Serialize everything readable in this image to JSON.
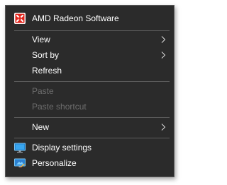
{
  "context_menu": {
    "items": [
      {
        "label": "AMD Radeon Software",
        "icon": "amd-radeon-icon",
        "enabled": true,
        "submenu": false
      },
      {
        "label": "View",
        "icon": "",
        "enabled": true,
        "submenu": true
      },
      {
        "label": "Sort by",
        "icon": "",
        "enabled": true,
        "submenu": true
      },
      {
        "label": "Refresh",
        "icon": "",
        "enabled": true,
        "submenu": false
      },
      {
        "label": "Paste",
        "icon": "",
        "enabled": false,
        "submenu": false
      },
      {
        "label": "Paste shortcut",
        "icon": "",
        "enabled": false,
        "submenu": false
      },
      {
        "label": "New",
        "icon": "",
        "enabled": true,
        "submenu": true
      },
      {
        "label": "Display settings",
        "icon": "display-settings-icon",
        "enabled": true,
        "submenu": false
      },
      {
        "label": "Personalize",
        "icon": "personalize-icon",
        "enabled": true,
        "submenu": false
      }
    ]
  },
  "colors": {
    "menu_background": "#2b2b2b",
    "text_enabled": "#ffffff",
    "text_disabled": "#6d6d6d",
    "separator": "#5e5e5e",
    "amd_red": "#e2231a"
  }
}
